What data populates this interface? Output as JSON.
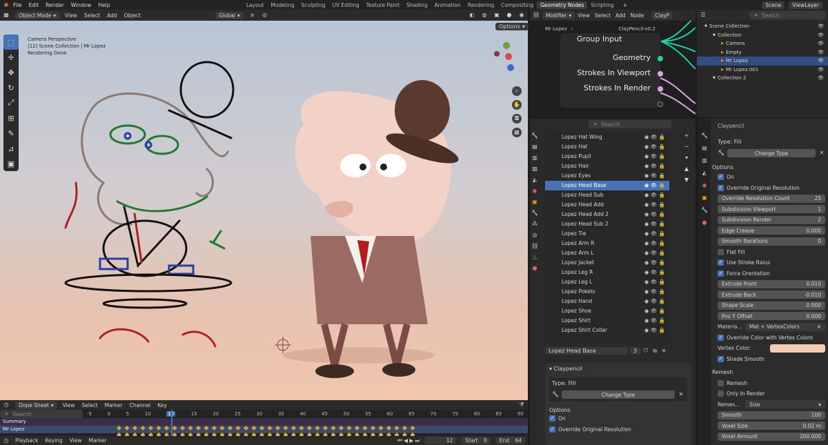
{
  "topbar": {
    "menus": [
      "File",
      "Edit",
      "Render",
      "Window",
      "Help"
    ],
    "workspaces": [
      "Layout",
      "Modeling",
      "Sculpting",
      "UV Editing",
      "Texture Paint",
      "Shading",
      "Animation",
      "Rendering",
      "Compositing",
      "Geometry Nodes",
      "Scripting"
    ],
    "active_workspace": "Geometry Nodes",
    "scene": "Scene",
    "view_layer": "ViewLayer"
  },
  "viewport": {
    "mode": "Object Mode",
    "menus": [
      "View",
      "Select",
      "Add",
      "Object"
    ],
    "orientation": "Global",
    "options": "Options",
    "info": [
      "Camera Perspective",
      "(12) Scene Collection | Mr Lopez",
      "Rendering Done"
    ]
  },
  "dope": {
    "editor": "Dope Sheet",
    "menus": [
      "View",
      "Select",
      "Marker",
      "Channel",
      "Key"
    ],
    "search": "Search",
    "frames": [
      "-5",
      "0",
      "5",
      "10",
      "12",
      "15",
      "20",
      "25",
      "30",
      "35",
      "40",
      "45",
      "50",
      "55",
      "60",
      "65",
      "70",
      "75",
      "80",
      "85",
      "90"
    ],
    "rows": [
      "Summary",
      "Mr Lopez"
    ],
    "playback": [
      "Playback",
      "Keying",
      "View",
      "Marker"
    ],
    "current": "12",
    "start_label": "Start",
    "start": "0",
    "end_label": "End",
    "end": "64"
  },
  "node_editor": {
    "editor": "Modifier",
    "menus": [
      "View",
      "Select",
      "Add",
      "Node"
    ],
    "breadcrumb": [
      "Mr Lopez",
      "ClayPencil-v0.2"
    ],
    "crumb_short": "ClayP",
    "node_title": "Group Input",
    "sockets": [
      "Geometry",
      "Strokes In Viewport",
      "Strokes In Render"
    ]
  },
  "outliner": {
    "search": "Search",
    "rows": [
      {
        "name": "Scene Collection",
        "indent": 0
      },
      {
        "name": "Collection",
        "indent": 1
      },
      {
        "name": "Camera",
        "indent": 2
      },
      {
        "name": "Empty",
        "indent": 2
      },
      {
        "name": "Mr Lopez",
        "indent": 2,
        "sel": true
      },
      {
        "name": "Mr Lopez.001",
        "indent": 2
      },
      {
        "name": "Collection 2",
        "indent": 1
      }
    ]
  },
  "layers": {
    "search": "Search",
    "items": [
      "Lopez Hat Wing",
      "Lopez Hat",
      "Lopez Pupil",
      "Lopez Hair",
      "Lopez Eyes",
      "Lopez Head Base",
      "Lopez Head Sub",
      "Lopez Head Add",
      "Lopez Head Add 2",
      "Lopez Head Sub 2",
      "Lopez Tie",
      "Lopez Arm R",
      "Lopez Arm L",
      "Lopez Jacket",
      "Lopez Leg R",
      "Lopez Leg L",
      "Lopez Pokets",
      "Lopez Hand",
      "Lopez Shoe",
      "Lopez Shirt",
      "Lopez Shirt Collar"
    ],
    "selected": "Lopez Head Base",
    "active_name": "Lopez Head Base",
    "users": "3"
  },
  "modifier_left": {
    "panel": "Claypencil",
    "type_label": "Type: Fill",
    "change_type": "Change Type",
    "options": "Options",
    "on": "On",
    "override": "Override Original Resolution"
  },
  "props": {
    "panel": "Claypencil",
    "type_label": "Type: Fill",
    "change_type": "Change Type",
    "options": "Options",
    "rows": [
      {
        "kind": "check",
        "label": "On",
        "on": true
      },
      {
        "kind": "check",
        "label": "Override Original Resolution",
        "on": true
      },
      {
        "kind": "field",
        "label": "Override  Resolution Count",
        "value": "25"
      },
      {
        "kind": "field",
        "label": "Subdivision Viewport",
        "value": "1"
      },
      {
        "kind": "field",
        "label": "Subdivision Render",
        "value": "2"
      },
      {
        "kind": "field",
        "label": "Edge Crease",
        "value": "0.000"
      },
      {
        "kind": "field",
        "label": "Smooth Iterations",
        "value": "0"
      },
      {
        "kind": "check",
        "label": "Flat Fill",
        "on": false
      },
      {
        "kind": "check",
        "label": "Use Stroke Raius",
        "on": true
      },
      {
        "kind": "check",
        "label": "Force Orentation",
        "on": true
      },
      {
        "kind": "field",
        "label": "Extrude Front",
        "value": "0.010"
      },
      {
        "kind": "field",
        "label": "Extrude Back",
        "value": "-0.010"
      },
      {
        "kind": "field",
        "label": "Shape Scale",
        "value": "0.900"
      },
      {
        "kind": "field",
        "label": "Pos Y Offset",
        "value": "0.000"
      }
    ],
    "material_label": "Materia...",
    "material": "Mat + VertexColors",
    "override_color": "Override Color with Vertex Colors",
    "vertex_color_label": "Vertex Color:",
    "vertex_color": "#f4cbb0",
    "shade_smooth": "Shade Smooth",
    "remesh_header": "Remesh",
    "remesh": "Remesh",
    "only_render": "Only In Render",
    "remesh_mode_label": "Remes...",
    "remesh_mode": "Size",
    "smooth_label": "Smooth",
    "smooth": "100",
    "voxel_label": "Voxel Size",
    "voxel": "0.02 m",
    "voxel_amount_label": "Voxel Amount",
    "voxel_amount": "200.000"
  }
}
